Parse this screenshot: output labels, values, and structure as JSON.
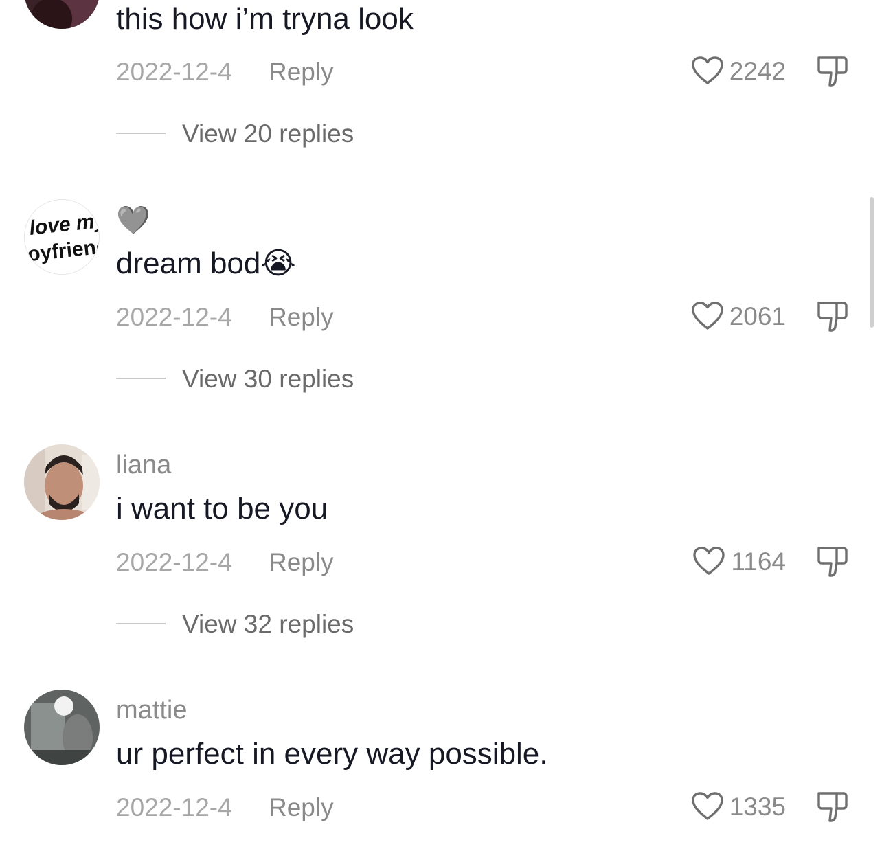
{
  "reply_label": "Reply",
  "comments": [
    {
      "username": "",
      "text": "this how i’m tryna look",
      "date": "2022-12-4",
      "likes": "2242",
      "view_replies": "View 20 replies"
    },
    {
      "username": "🩶",
      "text": "dream bod",
      "text_emoji": "😭",
      "date": "2022-12-4",
      "likes": "2061",
      "view_replies": "View 30 replies",
      "avatar_text": [
        "i love my",
        "boyfriend"
      ]
    },
    {
      "username": "liana",
      "text": "i want to be you",
      "date": "2022-12-4",
      "likes": "1164",
      "view_replies": "View 32 replies"
    },
    {
      "username": "mattie",
      "text": "ur perfect in every way possible.",
      "date": "2022-12-4",
      "likes": "1335"
    }
  ],
  "icons": {
    "like": "heart-outline-icon",
    "dislike": "thumbs-down-icon"
  },
  "colors": {
    "text_primary": "#161823",
    "text_secondary": "#8a8a8a",
    "text_date": "#a7a7a7",
    "scrollbar": "#cfcfcf"
  }
}
